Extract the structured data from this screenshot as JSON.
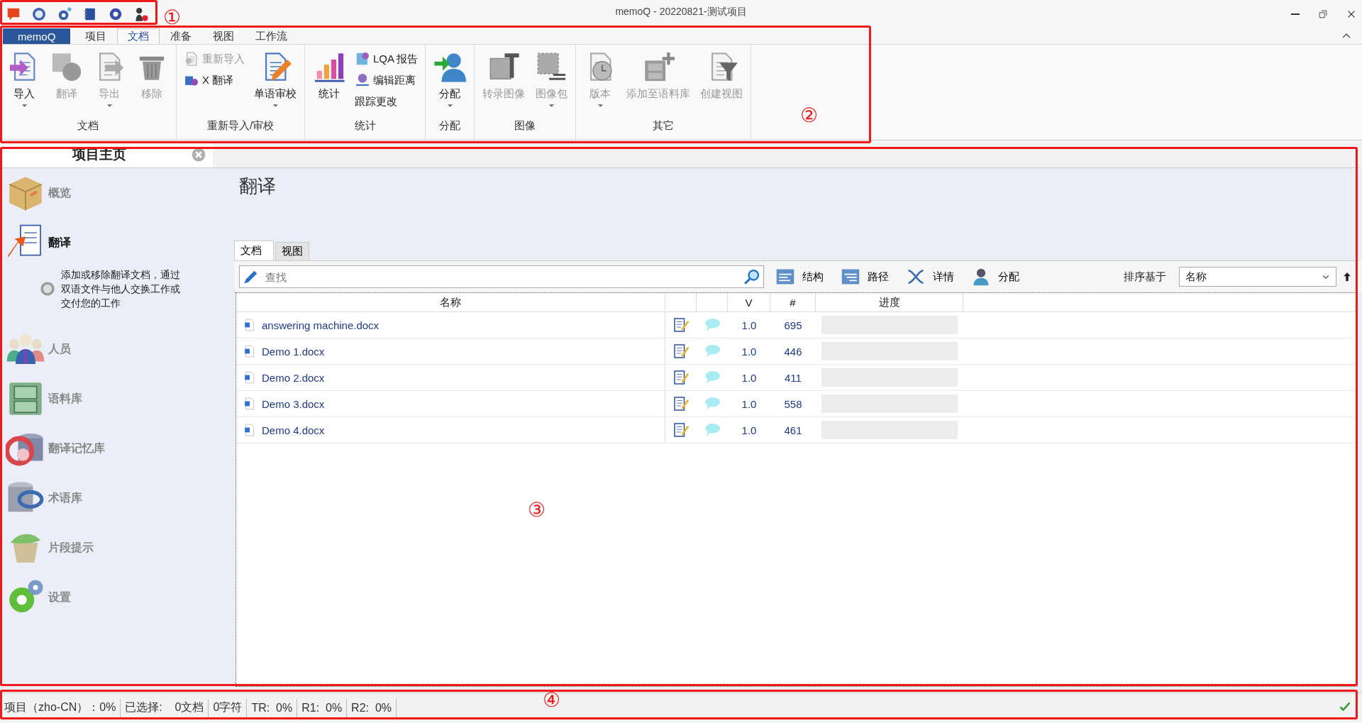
{
  "title_bar": {
    "title": "memoQ - 20220821-测试项目"
  },
  "ribbon_tabs": [
    {
      "label": "memoQ",
      "kind": "app",
      "selected": false
    },
    {
      "label": "项目",
      "kind": "tab",
      "selected": false
    },
    {
      "label": "文档",
      "kind": "tab",
      "selected": true
    },
    {
      "label": "准备",
      "kind": "tab",
      "selected": false
    },
    {
      "label": "视图",
      "kind": "tab",
      "selected": false
    },
    {
      "label": "工作流",
      "kind": "tab",
      "selected": false
    }
  ],
  "ribbon_groups": [
    {
      "label": "文档",
      "buttons": [
        {
          "label": "导入",
          "kind": "large",
          "disabled": false,
          "dropdown": true
        },
        {
          "label": "翻译",
          "kind": "large",
          "disabled": true,
          "dropdown": false
        },
        {
          "label": "导出",
          "kind": "large",
          "disabled": true,
          "dropdown": true
        },
        {
          "label": "移除",
          "kind": "large",
          "disabled": true,
          "dropdown": false
        }
      ]
    },
    {
      "label": "重新导入/审校",
      "buttons": [
        {
          "label": "重新导入",
          "kind": "small",
          "disabled": true,
          "dropdown": false
        },
        {
          "label": "X 翻译",
          "kind": "small",
          "disabled": false,
          "dropdown": false
        },
        {
          "label": "单语审校",
          "kind": "large",
          "disabled": false,
          "dropdown": true
        }
      ]
    },
    {
      "label": "统计",
      "buttons": [
        {
          "label": "统计",
          "kind": "large",
          "disabled": false,
          "dropdown": false
        },
        {
          "label": "LQA 报告",
          "kind": "small",
          "disabled": false,
          "dropdown": false
        },
        {
          "label": "编辑距离",
          "kind": "small",
          "disabled": false,
          "dropdown": false
        },
        {
          "label": "跟踪更改",
          "kind": "small",
          "disabled": false,
          "dropdown": false
        }
      ]
    },
    {
      "label": "分配",
      "buttons": [
        {
          "label": "分配",
          "kind": "large",
          "disabled": false,
          "dropdown": true
        }
      ]
    },
    {
      "label": "图像",
      "buttons": [
        {
          "label": "转录图像",
          "kind": "large",
          "disabled": true,
          "dropdown": false
        },
        {
          "label": "图像包",
          "kind": "large",
          "disabled": true,
          "dropdown": true
        }
      ]
    },
    {
      "label": "其它",
      "buttons": [
        {
          "label": "版本",
          "kind": "large",
          "disabled": true,
          "dropdown": true
        },
        {
          "label": "添加至语料库",
          "kind": "large",
          "disabled": true,
          "dropdown": false
        },
        {
          "label": "创建视图",
          "kind": "large",
          "disabled": true,
          "dropdown": false
        }
      ]
    }
  ],
  "sidebar": {
    "title": "项目主页",
    "items": [
      {
        "label": "概览",
        "selected": false
      },
      {
        "label": "翻译",
        "selected": true,
        "description": "添加或移除翻译文档，通过双语文件与他人交换工作或交付您的工作"
      },
      {
        "label": "人员",
        "selected": false
      },
      {
        "label": "语料库",
        "selected": false
      },
      {
        "label": "翻译记忆库",
        "selected": false
      },
      {
        "label": "术语库",
        "selected": false
      },
      {
        "label": "片段提示",
        "selected": false
      },
      {
        "label": "设置",
        "selected": false
      }
    ]
  },
  "page_title": "翻译",
  "sub_tabs": [
    {
      "label": "文档",
      "selected": true
    },
    {
      "label": "视图",
      "selected": false
    }
  ],
  "toolbar": {
    "search": {
      "placeholder": "查找"
    },
    "buttons": [
      "结构",
      "路径",
      "详情",
      "分配"
    ],
    "sort_label": "排序基于",
    "sort_value": "名称"
  },
  "table": {
    "columns": [
      {
        "kind": "text",
        "label": "名称"
      },
      {
        "kind": "icon"
      },
      {
        "kind": "icon"
      },
      {
        "kind": "text",
        "label": "V"
      },
      {
        "kind": "text",
        "label": "#"
      },
      {
        "kind": "text",
        "label": "进度"
      }
    ],
    "rows": [
      {
        "name": "answering machine.docx",
        "version": "1.0",
        "count": "695",
        "level": 0
      },
      {
        "name": "Demo 1.docx",
        "version": "1.0",
        "count": "446",
        "level": 0
      },
      {
        "name": "Demo 2.docx",
        "version": "1.0",
        "count": "411",
        "level": 0
      },
      {
        "name": "Demo 3.docx",
        "version": "1.0",
        "count": "558",
        "level": 0
      },
      {
        "name": "Demo 4.docx",
        "version": "1.0",
        "count": "461",
        "level": 0
      }
    ]
  },
  "status_bar": {
    "segments": [
      "项目（zho-CN）：0%",
      "已选择:    0文档",
      "0字符",
      "TR:  0%",
      "R1:  0%",
      "R2:  0%"
    ]
  },
  "annotations": [
    {
      "number": "①"
    },
    {
      "number": "②"
    },
    {
      "number": "③"
    },
    {
      "number": "④"
    }
  ]
}
